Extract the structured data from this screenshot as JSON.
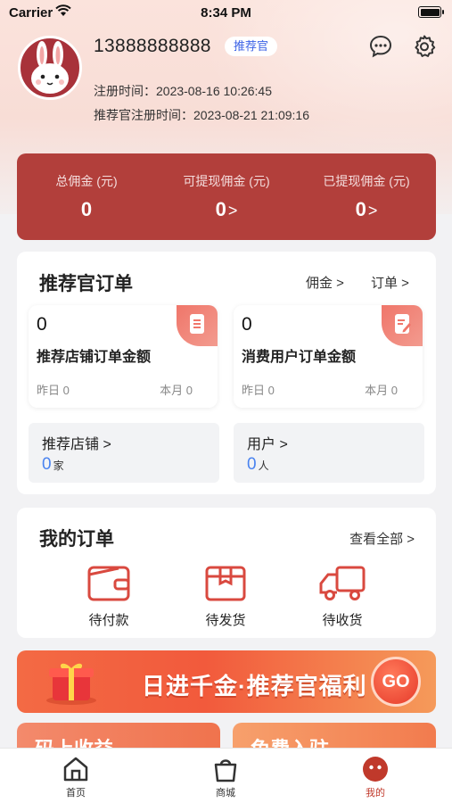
{
  "status_bar": {
    "carrier": "Carrier",
    "time": "8:34 PM"
  },
  "profile": {
    "phone": "13888888888",
    "role_badge": "推荐官",
    "register_time": "注册时间：2023-08-16 10:26:45",
    "referrer_register_time": "推荐官注册时间：2023-08-21 21:09:16"
  },
  "header_icons": [
    "message-icon",
    "settings-icon"
  ],
  "commission": {
    "items": [
      {
        "label": "总佣金 (元)",
        "value": "0",
        "has_chevron": false
      },
      {
        "label": "可提现佣金 (元)",
        "value": "0",
        "has_chevron": true
      },
      {
        "label": "已提现佣金 (元)",
        "value": "0",
        "has_chevron": true
      }
    ]
  },
  "referrer_orders": {
    "title": "推荐官订单",
    "commission_link": "佣金 >",
    "orders_link": "订单 >",
    "store_card": {
      "amount": "0",
      "title": "推荐店铺订单金额",
      "yesterday": "昨日 0",
      "month": "本月 0"
    },
    "user_card": {
      "amount": "0",
      "title": "消费用户订单金额",
      "yesterday": "昨日 0",
      "month": "本月 0"
    },
    "store_stat": {
      "label": "推荐店铺 >",
      "value": "0",
      "unit": "家"
    },
    "user_stat": {
      "label": "用户 >",
      "value": "0",
      "unit": "人"
    }
  },
  "my_orders": {
    "title": "我的订单",
    "view_all": "查看全部 >",
    "items": [
      {
        "label": "待付款",
        "icon": "wallet-icon"
      },
      {
        "label": "待发货",
        "icon": "package-icon"
      },
      {
        "label": "待收货",
        "icon": "truck-icon"
      }
    ]
  },
  "banner": {
    "text": "日进千金·推荐官福利",
    "button": "GO"
  },
  "promos": {
    "left": "码上收益",
    "right": "免费入驻"
  },
  "tabbar": {
    "items": [
      {
        "label": "首页",
        "icon": "home-icon"
      },
      {
        "label": "商城",
        "icon": "shopping-bag-icon"
      },
      {
        "label": "我的",
        "icon": "profile-face-icon"
      }
    ],
    "active_index": 2
  },
  "colors": {
    "brand_red": "#b23f3b",
    "accent_blue": "#3b62e6",
    "stat_blue": "#4a83f0",
    "active_tab": "#c0392b"
  }
}
